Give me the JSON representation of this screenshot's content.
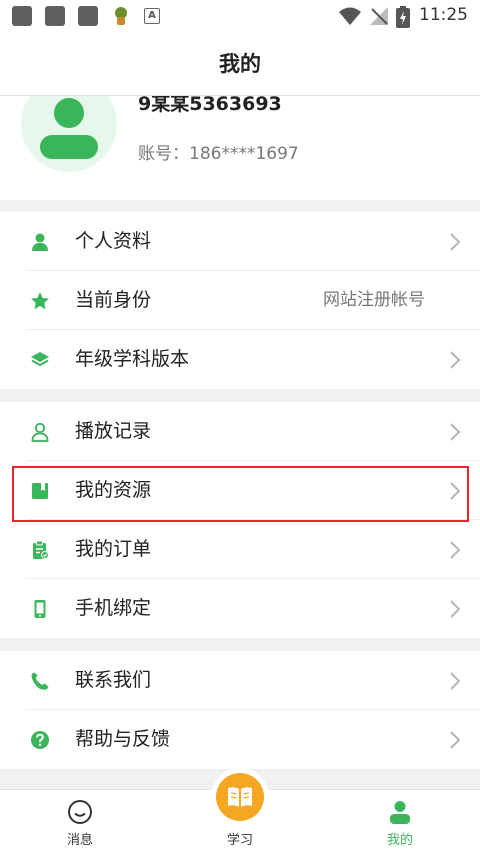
{
  "status_bar": {
    "time": "11:25",
    "notification_a": "A"
  },
  "header": {
    "title": "我的"
  },
  "profile": {
    "username": "9某某5363693",
    "account": "账号：186****1697"
  },
  "menu": [
    {
      "label": "个人资料",
      "icon": "person-icon"
    },
    {
      "label": "当前身份",
      "value": "网站注册帐号",
      "icon": "star-icon"
    },
    {
      "label": "年级学科版本",
      "icon": "layers-icon"
    },
    {
      "label": "播放记录",
      "icon": "person-outline-icon"
    },
    {
      "label": "我的资源",
      "icon": "book-icon"
    },
    {
      "label": "我的订单",
      "icon": "clipboard-icon"
    },
    {
      "label": "手机绑定",
      "icon": "phone-icon"
    },
    {
      "label": "联系我们",
      "icon": "call-icon"
    },
    {
      "label": "帮助与反馈",
      "icon": "help-icon"
    }
  ],
  "tabs": {
    "messages": "消息",
    "study": "学习",
    "mine": "我的"
  },
  "colors": {
    "accent": "#3ab55a",
    "study_button": "#f5a623",
    "highlight": "#e8262c"
  }
}
